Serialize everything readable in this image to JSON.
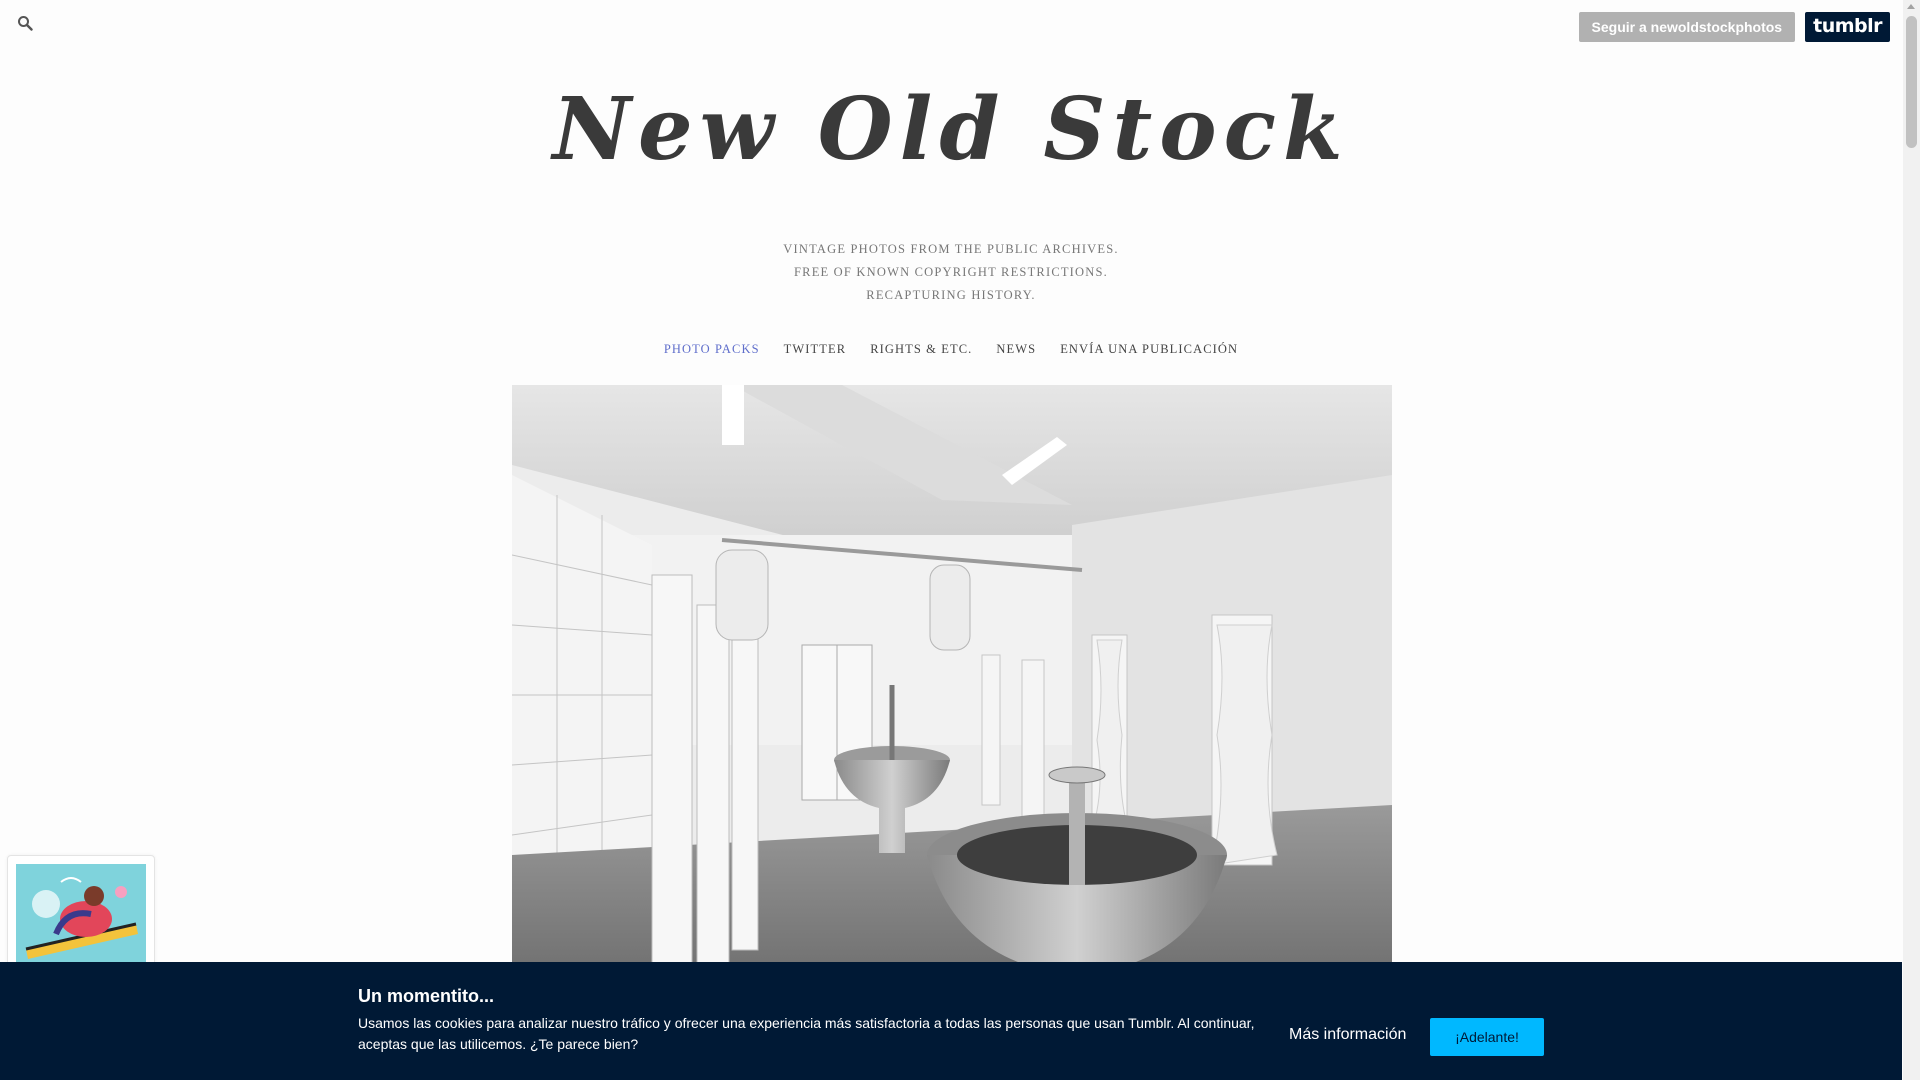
{
  "topbar": {
    "search_icon": "search-icon",
    "follow_label": "Seguir a newoldstockphotos",
    "logo_text": "tumblr"
  },
  "header": {
    "title": "New Old Stock",
    "description": [
      "VINTAGE PHOTOS FROM THE PUBLIC ARCHIVES.",
      "FREE OF KNOWN COPYRIGHT RESTRICTIONS.",
      "RECAPTURING HISTORY."
    ]
  },
  "nav": {
    "items": [
      {
        "label": "PHOTO PACKS",
        "active": true
      },
      {
        "label": "TWITTER"
      },
      {
        "label": "RIGHTS & ETC."
      },
      {
        "label": "NEWS"
      },
      {
        "label": "ENVÍA UNA PUBLICACIÓN"
      }
    ],
    "active_color": "#5f6ecb"
  },
  "post": {
    "image": "black-and-white photo of a tiled washroom with shower stalls and circular communal washbasins"
  },
  "cookie_banner": {
    "title": "Un momentito...",
    "text": "Usamos las cookies para analizar nuestro tráfico y ofrecer una experiencia más satisfactoria a todas las personas que usan Tumblr. Al continuar, aceptas que las utilicemos. ¿Te parece bien?",
    "more_label": "Más información",
    "accept_label": "¡Adelante!",
    "bg_color": "#001935",
    "accent_color": "#00b8ff"
  }
}
